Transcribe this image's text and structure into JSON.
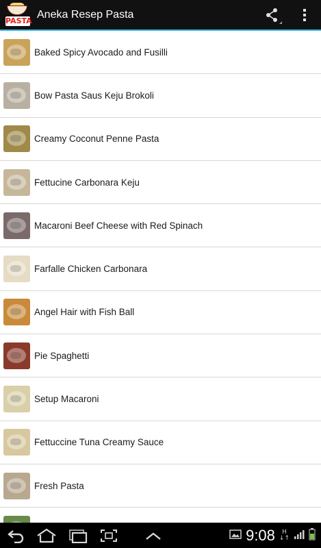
{
  "app": {
    "title": "Aneka Resep Pasta",
    "logo_text": "PASTA",
    "accent_color": "#33b5e5"
  },
  "toolbar": {
    "share_icon": "share-icon",
    "overflow_icon": "overflow-menu-icon"
  },
  "recipes": [
    {
      "label": "Baked Spicy Avocado and Fusilli",
      "thumb_color": "#c9a35a"
    },
    {
      "label": "Bow Pasta Saus Keju Brokoli",
      "thumb_color": "#b8b0a0"
    },
    {
      "label": "Creamy Coconut Penne Pasta",
      "thumb_color": "#a08a4a"
    },
    {
      "label": "Fettucine Carbonara Keju",
      "thumb_color": "#c7b79a"
    },
    {
      "label": "Macaroni Beef Cheese with Red Spinach",
      "thumb_color": "#7a6a6a"
    },
    {
      "label": "Farfalle Chicken Carbonara",
      "thumb_color": "#e6dcc4"
    },
    {
      "label": "Angel Hair with Fish Ball",
      "thumb_color": "#c98a3a"
    },
    {
      "label": "Pie Spaghetti",
      "thumb_color": "#8a3a2a"
    },
    {
      "label": "Setup Macaroni",
      "thumb_color": "#d9cfa8"
    },
    {
      "label": "Fettuccine Tuna Creamy Sauce",
      "thumb_color": "#d8c8a0"
    },
    {
      "label": "Fresh Pasta",
      "thumb_color": "#b8a890"
    },
    {
      "label": "",
      "thumb_color": "#6a8a4a"
    }
  ],
  "status_bar": {
    "time": "9:08",
    "network_top": "H",
    "network_bottom": "↓↑"
  },
  "nav": {
    "back_icon": "back-icon",
    "home_icon": "home-icon",
    "recents_icon": "recent-apps-icon",
    "screenshot_icon": "screenshot-icon",
    "up_icon": "chevron-up-icon"
  }
}
